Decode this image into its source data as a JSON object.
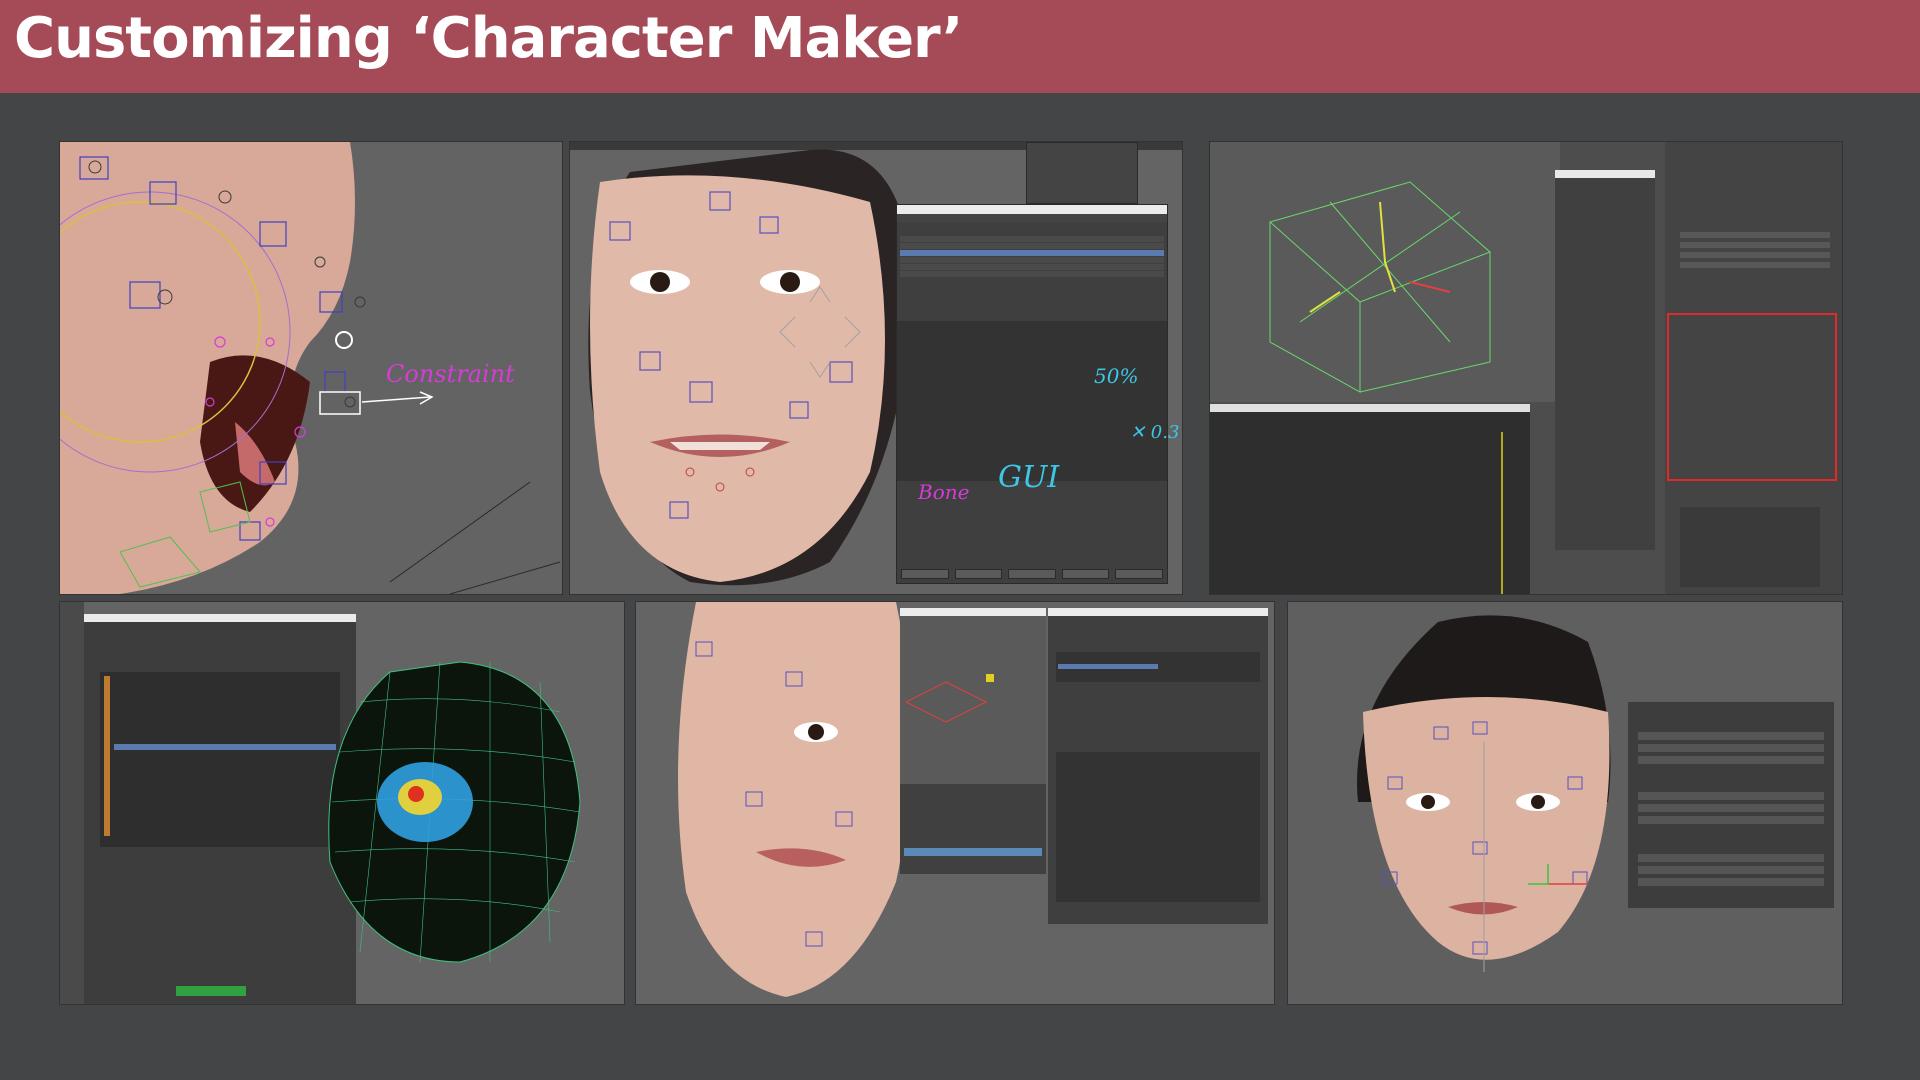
{
  "slide": {
    "title": "Customizing ‘Character Maker’"
  },
  "annotations": {
    "constraint": "Constraint",
    "bone": "Bone",
    "gui": "GUI",
    "percent": "50%",
    "multiplier": "✕ 0.3"
  },
  "colors": {
    "header": "#a54a57",
    "background": "#444546",
    "annotation_magenta": "#d63cd6",
    "annotation_cyan": "#3ec6e6",
    "highlight_red": "#e02a2a"
  }
}
